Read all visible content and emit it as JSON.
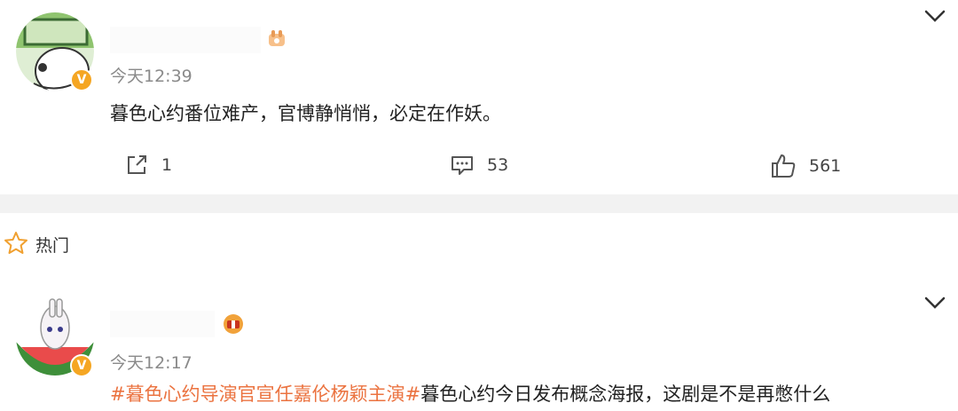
{
  "post1": {
    "timestamp": "今天12:39",
    "text": "暮色心约番位难产，官博静悄悄，必定在作妖。",
    "actions": {
      "share_count": "1",
      "comment_count": "53",
      "like_count": "561"
    },
    "icons": [
      "avatar",
      "verified-badge-icon",
      "member-badge-icon",
      "chevron-down-icon",
      "share-icon",
      "comment-icon",
      "like-icon"
    ]
  },
  "hot_section": {
    "label": "热门",
    "icon": "star-icon"
  },
  "post2": {
    "timestamp": "今天12:17",
    "hashtag": "#暮色心约导演官宣任嘉伦杨颖主演#",
    "text": "暮色心约今日发布概念海报，这剧是不是再憋什么",
    "icons": [
      "avatar",
      "verified-badge-icon",
      "member-badge-icon",
      "chevron-down-icon"
    ]
  },
  "colors": {
    "accent": "#eb7340",
    "verified": "#f5a623",
    "divider": "#f2f2f2",
    "meta_text": "#8a8a8a"
  }
}
